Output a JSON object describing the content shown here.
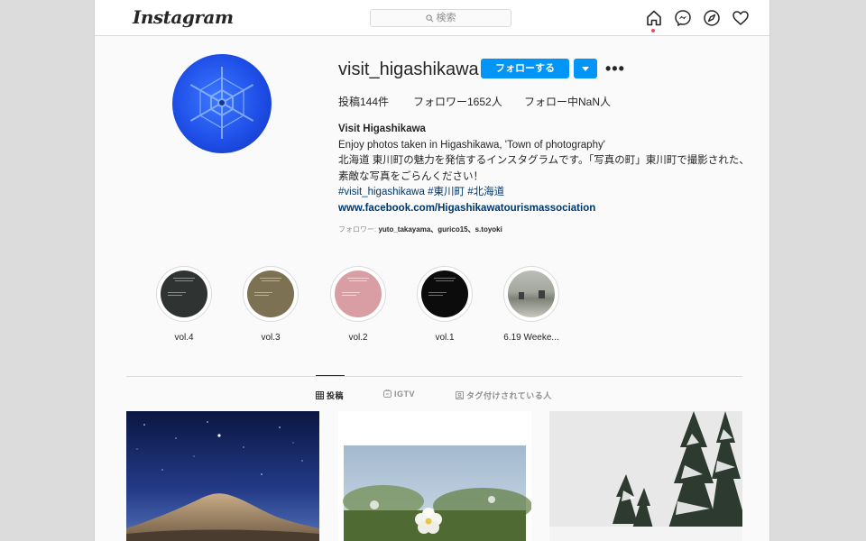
{
  "header": {
    "logo": "Instagram",
    "search_placeholder": "検索",
    "nav_icons": [
      "home-icon",
      "messenger-icon",
      "explore-icon",
      "heart-icon"
    ]
  },
  "profile": {
    "username": "visit_higashikawa",
    "follow_label": "フォローする",
    "stats": {
      "posts": "投稿144件",
      "followers": "フォロワー1652人",
      "following": "フォロー中NaN人"
    },
    "name": "Visit Higashikawa",
    "bio_line1": "Enjoy photos taken in Higashikawa, 'Town of photography'",
    "bio_line2": "北海道 東川町の魅力を発信するインスタグラムです。「写真の町」東川町で撮影された、素敵な写真をごらんください！",
    "hashtags": [
      "#visit_higashikawa",
      "#東川町",
      "#北海道"
    ],
    "website": "www.facebook.com/Higashikawatourismassociation",
    "followed_by_prefix": "フォロワー: ",
    "followed_by": "yuto_takayama、gurico15、s.toyoki"
  },
  "highlights": [
    {
      "label": "vol.4",
      "color": "#2f3432"
    },
    {
      "label": "vol.3",
      "color": "#7c7253"
    },
    {
      "label": "vol.2",
      "color": "#d99ea4"
    },
    {
      "label": "vol.1",
      "color": "#0c0c0c"
    },
    {
      "label": "6.19 Weeke...",
      "color": "#9aa29a"
    }
  ],
  "tabs": [
    {
      "label": "投稿",
      "icon": "grid-icon",
      "active": true
    },
    {
      "label": "IGTV",
      "icon": "igtv-icon",
      "active": false
    },
    {
      "label": "タグ付けされている人",
      "icon": "tagged-icon",
      "active": false
    }
  ],
  "posts": [
    "night-sky-mountain-photo",
    "white-flower-photo",
    "snowy-trees-photo"
  ],
  "colors": {
    "accent": "#0095f6",
    "link": "#00376b",
    "background": "#fafafa"
  }
}
